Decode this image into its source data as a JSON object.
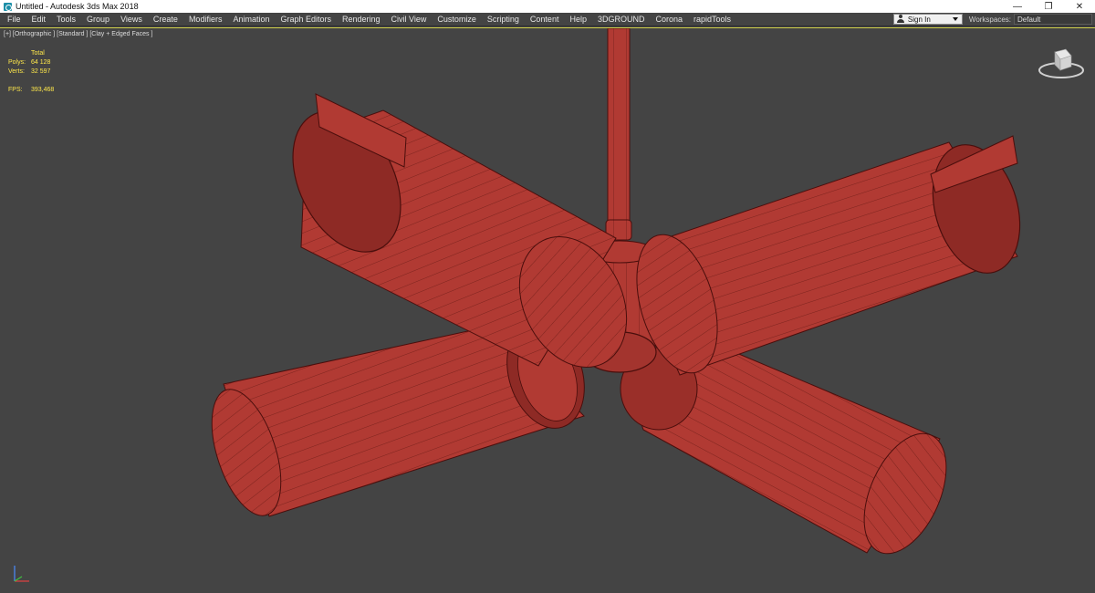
{
  "window": {
    "title": "Untitled - Autodesk 3ds Max 2018",
    "app_icon": "3ds-max-icon",
    "controls": {
      "minimize": "—",
      "restore": "❐",
      "close": "✕"
    }
  },
  "menubar": {
    "items": [
      "File",
      "Edit",
      "Tools",
      "Group",
      "Views",
      "Create",
      "Modifiers",
      "Animation",
      "Graph Editors",
      "Rendering",
      "Civil View",
      "Customize",
      "Scripting",
      "Content",
      "Help",
      "3DGROUND",
      "Corona",
      "rapidTools"
    ],
    "sign_in": "Sign In",
    "workspaces_label": "Workspaces:",
    "workspaces_value": "Default"
  },
  "viewport": {
    "label": "[+] [Orthographic ] [Standard ] [Clay + Edged Faces ]",
    "stats": {
      "total": "Total",
      "polys_label": "Polys:",
      "polys_value": "64 128",
      "verts_label": "Verts:",
      "verts_value": "32 597",
      "fps_label": "FPS:",
      "fps_value": "393,468"
    },
    "colors": {
      "background": "#444444",
      "model_fill": "#b13a33",
      "model_edges": "#4a0e0c",
      "stats_text": "#ffe84a",
      "border_active": "#cfcf4a"
    }
  }
}
